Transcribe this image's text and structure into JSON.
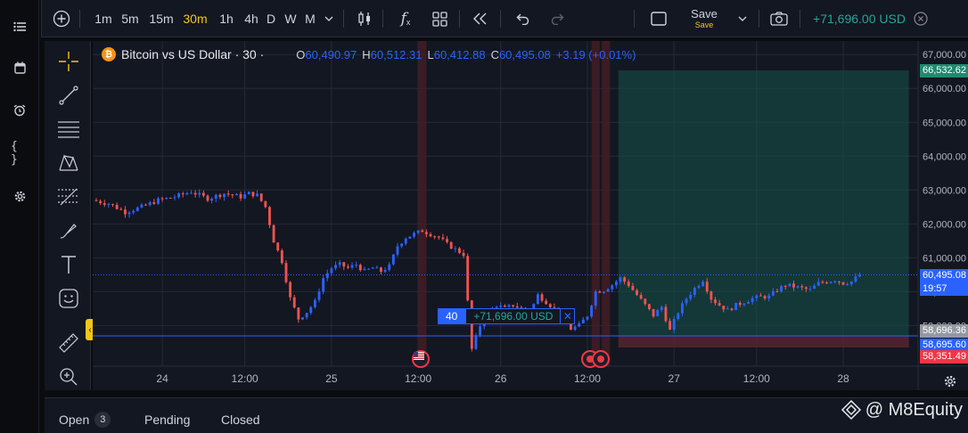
{
  "timeframes": [
    "1m",
    "5m",
    "15m",
    "30m",
    "1h",
    "4h",
    "D",
    "W",
    "M"
  ],
  "active_timeframe": "30m",
  "toolbar": {
    "save_label": "Save",
    "save_sub": "Save",
    "pnl_total": "+71,696.00 USD"
  },
  "legend": {
    "symbol": "Bitcoin vs US Dollar · 30 ·",
    "o_key": "O",
    "o": "60,490.97",
    "h_key": "H",
    "h": "60,512.31",
    "l_key": "L",
    "l": "60,412.88",
    "c_key": "C",
    "c": "60,495.08",
    "change": "+3.19 (+0.01%)"
  },
  "colors": {
    "up": "#2962ff",
    "down": "#ef5350",
    "take_profit_zone": "#16524a",
    "stop_loss_zone": "#5a2630",
    "entry_line": "#2962ff",
    "accent": "#f5c518"
  },
  "price_axis_labels": [
    "67,000.00",
    "66,000.00",
    "65,000.00",
    "64,000.00",
    "63,000.00",
    "62,000.00",
    "61,000.00",
    "60,000.00",
    "59,000.00"
  ],
  "price_tags": {
    "take_profit": "66,532.62",
    "current_price": "60,495.08",
    "countdown": "19:57",
    "position_gray": "58,696.36",
    "entry": "58,695.60",
    "stop_loss": "58,351.49"
  },
  "time_axis_labels": [
    "24",
    "12:00",
    "25",
    "12:00",
    "26",
    "12:00",
    "27",
    "12:00",
    "28"
  ],
  "position": {
    "quantity": "40",
    "pnl": "+71,696.00 USD",
    "close_icon": "close-icon"
  },
  "bottom": {
    "open_label": "Open",
    "open_count": "3",
    "pending_label": "Pending",
    "closed_label": "Closed"
  },
  "watermark": "@ M8Equity",
  "chart_data": {
    "type": "candlestick",
    "symbol": "BTCUSD",
    "interval": "30m",
    "y_range": [
      57800,
      67400
    ],
    "x_ticks": [
      "24",
      "12:00",
      "25",
      "12:00",
      "26",
      "12:00",
      "27",
      "12:00",
      "28"
    ],
    "path_close": [
      [
        0,
        62700
      ],
      [
        4,
        62600
      ],
      [
        8,
        62350
      ],
      [
        12,
        62500
      ],
      [
        16,
        62700
      ],
      [
        20,
        62800
      ],
      [
        24,
        62950
      ],
      [
        28,
        62750
      ],
      [
        32,
        62900
      ],
      [
        36,
        62800
      ],
      [
        38,
        62900
      ],
      [
        40,
        62850
      ],
      [
        42,
        62500
      ],
      [
        44,
        61500
      ],
      [
        46,
        60900
      ],
      [
        48,
        59800
      ],
      [
        50,
        59200
      ],
      [
        52,
        59400
      ],
      [
        54,
        59700
      ],
      [
        56,
        60400
      ],
      [
        58,
        60700
      ],
      [
        60,
        60800
      ],
      [
        62,
        60700
      ],
      [
        64,
        60800
      ],
      [
        66,
        60600
      ],
      [
        68,
        60700
      ],
      [
        70,
        60600
      ],
      [
        72,
        60750
      ],
      [
        74,
        61350
      ],
      [
        76,
        61600
      ],
      [
        78,
        61700
      ],
      [
        80,
        61800
      ],
      [
        82,
        61700
      ],
      [
        84,
        61600
      ],
      [
        86,
        61400
      ],
      [
        88,
        61250
      ],
      [
        90,
        61100
      ],
      [
        92,
        58300
      ],
      [
        94,
        59000
      ],
      [
        96,
        59400
      ],
      [
        98,
        59600
      ],
      [
        100,
        59500
      ],
      [
        102,
        59600
      ],
      [
        104,
        59500
      ],
      [
        106,
        59350
      ],
      [
        108,
        59900
      ],
      [
        110,
        59700
      ],
      [
        112,
        59500
      ],
      [
        114,
        59200
      ],
      [
        116,
        58900
      ],
      [
        118,
        59000
      ],
      [
        120,
        59300
      ],
      [
        122,
        60000
      ],
      [
        124,
        60050
      ],
      [
        126,
        60200
      ],
      [
        128,
        60400
      ],
      [
        130,
        60200
      ],
      [
        132,
        59900
      ],
      [
        134,
        59600
      ],
      [
        136,
        59300
      ],
      [
        138,
        59550
      ],
      [
        140,
        58850
      ],
      [
        142,
        59400
      ],
      [
        144,
        59800
      ],
      [
        146,
        60100
      ],
      [
        148,
        60350
      ],
      [
        150,
        59800
      ],
      [
        152,
        59600
      ],
      [
        154,
        59450
      ],
      [
        156,
        59600
      ],
      [
        158,
        59700
      ],
      [
        160,
        59800
      ],
      [
        162,
        59850
      ],
      [
        164,
        59850
      ],
      [
        166,
        60050
      ],
      [
        168,
        60200
      ],
      [
        170,
        60150
      ],
      [
        172,
        60100
      ],
      [
        174,
        60050
      ],
      [
        176,
        60250
      ],
      [
        178,
        60300
      ],
      [
        180,
        60350
      ],
      [
        182,
        60250
      ],
      [
        184,
        60300
      ],
      [
        186,
        60495
      ]
    ],
    "entry_price": 58695.6,
    "take_profit_price": 66532.62,
    "stop_loss_price": 58351.49,
    "current_price": 60495.08
  }
}
